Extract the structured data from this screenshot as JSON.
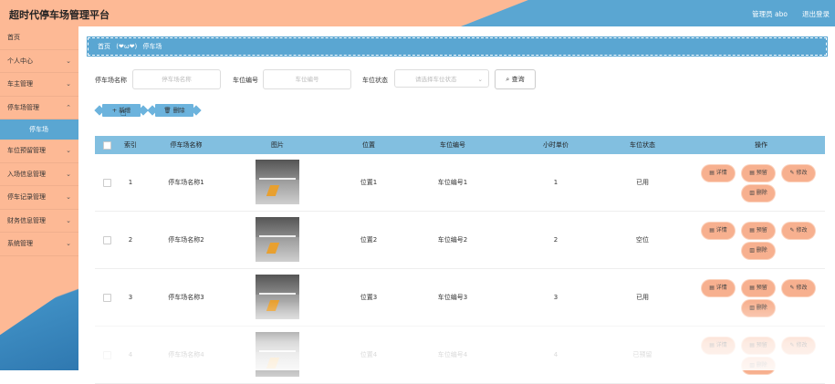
{
  "header": {
    "title": "超时代停车场管理平台",
    "user_label": "管理员 abo",
    "logout_label": "退出登录"
  },
  "sidebar": {
    "items": [
      {
        "label": "首页",
        "has_arrow": false
      },
      {
        "label": "个人中心",
        "has_arrow": true
      },
      {
        "label": "车主管理",
        "has_arrow": true
      },
      {
        "label": "停车场管理",
        "has_arrow": true
      },
      {
        "label": "车位预留管理",
        "has_arrow": true
      },
      {
        "label": "入场信息管理",
        "has_arrow": true
      },
      {
        "label": "停车记录管理",
        "has_arrow": true
      },
      {
        "label": "财务信息管理",
        "has_arrow": true
      },
      {
        "label": "系统管理",
        "has_arrow": true
      }
    ],
    "active_sub": "停车场"
  },
  "breadcrumb": {
    "home": "首页",
    "separator": "(❤ω❤)",
    "current": "停车场"
  },
  "filters": {
    "name_label": "停车场名称",
    "name_placeholder": "停车场名称",
    "number_label": "车位编号",
    "number_placeholder": "车位编号",
    "status_label": "车位状态",
    "status_placeholder": "请选择车位状态",
    "query_label": "查询"
  },
  "actions": {
    "add_label": "新增",
    "delete_label": "删除"
  },
  "table": {
    "columns": [
      "索引",
      "停车场名称",
      "图片",
      "位置",
      "车位编号",
      "小时单价",
      "车位状态",
      "操作"
    ],
    "rows": [
      {
        "index": "1",
        "name": "停车场名称1",
        "location": "位置1",
        "number": "车位编号1",
        "price": "1",
        "status": "已用"
      },
      {
        "index": "2",
        "name": "停车场名称2",
        "location": "位置2",
        "number": "车位编号2",
        "price": "2",
        "status": "空位"
      },
      {
        "index": "3",
        "name": "停车场名称3",
        "location": "位置3",
        "number": "车位编号3",
        "price": "3",
        "status": "已用"
      },
      {
        "index": "4",
        "name": "停车场名称4",
        "location": "位置4",
        "number": "车位编号4",
        "price": "4",
        "status": "已预留"
      }
    ],
    "op_labels": {
      "detail": "详情",
      "reserve": "预留",
      "edit": "修改",
      "delete": "删除"
    }
  },
  "colors": {
    "peach": "#fdb995",
    "blue": "#5aa6d2",
    "op_button": "#f7b08f"
  }
}
